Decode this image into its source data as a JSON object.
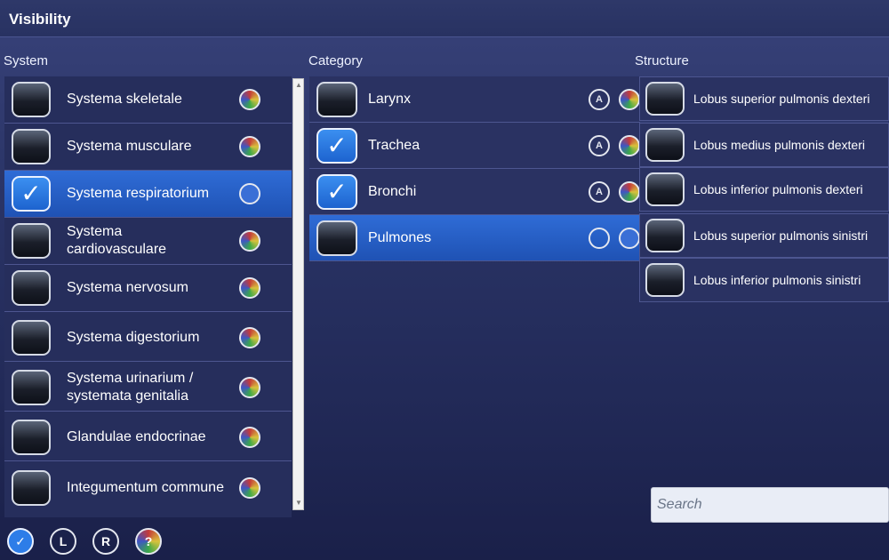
{
  "window": {
    "title": "Visibility"
  },
  "columns": {
    "system": "System",
    "category": "Category",
    "structure": "Structure"
  },
  "system": {
    "items": [
      {
        "label": "Systema skeletale",
        "checked": false,
        "selected": false
      },
      {
        "label": "Systema musculare",
        "checked": false,
        "selected": false
      },
      {
        "label": "Systema respiratorium",
        "checked": true,
        "selected": true
      },
      {
        "label": "Systema cardiovasculare",
        "checked": false,
        "selected": false
      },
      {
        "label": "Systema nervosum",
        "checked": false,
        "selected": false
      },
      {
        "label": "Systema digestorium",
        "checked": false,
        "selected": false
      },
      {
        "label": "Systema urinarium / systemata genitalia",
        "checked": false,
        "selected": false
      },
      {
        "label": "Glandulae endocrinae",
        "checked": false,
        "selected": false
      },
      {
        "label": "Integumentum commune",
        "checked": false,
        "selected": false
      }
    ]
  },
  "category": {
    "items": [
      {
        "label": "Larynx",
        "checked": false,
        "selected": false
      },
      {
        "label": "Trachea",
        "checked": true,
        "selected": false
      },
      {
        "label": "Bronchi",
        "checked": true,
        "selected": false
      },
      {
        "label": "Pulmones",
        "checked": false,
        "selected": true
      }
    ],
    "side_button_label": "A"
  },
  "structure": {
    "items": [
      {
        "label": "Lobus superior pulmonis dexteri"
      },
      {
        "label": "Lobus medius pulmonis dexteri"
      },
      {
        "label": "Lobus inferior pulmonis dexteri"
      },
      {
        "label": "Lobus superior pulmonis sinistri"
      },
      {
        "label": "Lobus inferior pulmonis sinistri"
      }
    ]
  },
  "search": {
    "placeholder": "Search"
  },
  "bottom_bar": {
    "check_mark": "✓",
    "left_label": "L",
    "right_label": "R",
    "help_mark": "?"
  },
  "glyphs": {
    "check": "✓",
    "scroll_up": "▲",
    "scroll_down": "▼"
  },
  "colors": {
    "selection": "#2a62cc",
    "background": "#262e5c"
  }
}
